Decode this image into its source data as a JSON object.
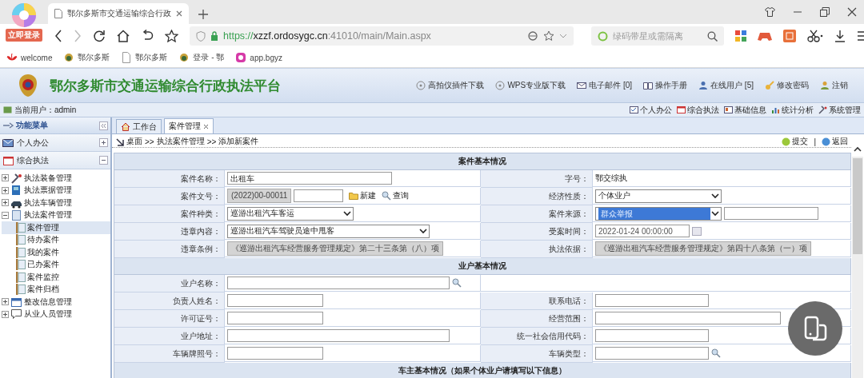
{
  "browser": {
    "tabs": [
      {
        "title": "鄂尔多斯市交通运输综合行政",
        "selected": true
      }
    ],
    "login_badge": "立即登录",
    "address": {
      "scheme": "https://",
      "host": "xzzf.ordosygc.cn",
      "path": ":41010/main/Main.aspx"
    },
    "search": {
      "placeholder": "绿码带星或需隔离"
    },
    "bookmarks": [
      {
        "label": "welcome"
      },
      {
        "label": "鄂尔多斯"
      },
      {
        "label": "鄂尔多斯"
      },
      {
        "label": "登录 - 鄂"
      },
      {
        "label": "app.bgyz"
      }
    ]
  },
  "app": {
    "title": "鄂尔多斯市交通运输综合行政执法平台",
    "links": [
      {
        "label": "高拍仪插件下载"
      },
      {
        "label": "WPS专业版下载"
      },
      {
        "label": "电子邮件 [0]"
      },
      {
        "label": "操作手册"
      },
      {
        "label": "在线用户 [5]"
      },
      {
        "label": "修改密码"
      },
      {
        "label": "注销"
      }
    ]
  },
  "user_bar": {
    "label": "当前用户：",
    "user": "admin",
    "modules": [
      {
        "label": "个人办公"
      },
      {
        "label": "综合执法"
      },
      {
        "label": "基础信息"
      },
      {
        "label": "统计分析"
      },
      {
        "label": "系统管理"
      }
    ]
  },
  "sidebar": {
    "title": "功能菜单",
    "panels": [
      {
        "label": "个人办公",
        "expanded": false
      },
      {
        "label": "综合执法",
        "expanded": true
      }
    ],
    "tree": [
      {
        "label": "执法装备管理",
        "expanded": false
      },
      {
        "label": "执法票据管理",
        "expanded": false
      },
      {
        "label": "执法车辆管理",
        "expanded": false
      },
      {
        "label": "执法案件管理",
        "expanded": true,
        "children": [
          {
            "label": "案件管理",
            "selected": true
          },
          {
            "label": "待办案件",
            "selected": false
          },
          {
            "label": "我的案件",
            "selected": false
          },
          {
            "label": "已办案件",
            "selected": false
          },
          {
            "label": "案件监控",
            "selected": false
          },
          {
            "label": "案件归档",
            "selected": false
          }
        ]
      },
      {
        "label": "整改信息管理",
        "expanded": false
      },
      {
        "label": "从业人员管理",
        "expanded": false
      }
    ]
  },
  "tabs": [
    {
      "label": "工作台",
      "selected": false,
      "closable": false
    },
    {
      "label": "案件管理",
      "selected": true,
      "closable": true
    }
  ],
  "breadcrumb": {
    "items": [
      "桌面",
      "执法案件管理",
      "添加新案件"
    ],
    "separator": ">>"
  },
  "actions": {
    "items": [
      {
        "label": "提交"
      },
      {
        "label": "返回"
      }
    ],
    "separator": "|"
  },
  "form": {
    "sections": [
      {
        "title": "案件基本情况",
        "rows": [
          [
            {
              "label": "案件名称：",
              "kind": "text",
              "value": "出租车"
            },
            {
              "label": "字号：",
              "kind": "static",
              "value": "鄂交综执"
            }
          ],
          [
            {
              "label": "案件文号：",
              "kind": "readonly",
              "value": "(2022)00-00011",
              "extra_input": true,
              "actions": [
                "新建",
                "查询"
              ]
            },
            {
              "label": "经济性质：",
              "kind": "select",
              "value": "个体业户"
            }
          ],
          [
            {
              "label": "案件种类：",
              "kind": "select",
              "value": "巡游出租汽车客运"
            },
            {
              "label": "案件来源：",
              "kind": "select",
              "value": "群众举报",
              "highlighted": true,
              "extra_input": true
            }
          ],
          [
            {
              "label": "违章内容：",
              "kind": "select",
              "value": "巡游出租汽车驾驶员途中甩客"
            },
            {
              "label": "受案时间：",
              "kind": "date",
              "value": "2022-01-24 00:00:00"
            }
          ],
          [
            {
              "label": "违章条例：",
              "kind": "readonly",
              "value": "《巡游出租汽车经营服务管理规定》第二十三条第（八）项"
            },
            {
              "label": "执法依据：",
              "kind": "readonly",
              "value": "《巡游出租汽车经营服务管理规定》第四十八条第（一）项"
            }
          ]
        ]
      },
      {
        "title": "业户基本情况",
        "rows": [
          [
            {
              "label": "业户名称：",
              "kind": "text",
              "lookup": true
            },
            null
          ],
          [
            {
              "label": "负责人姓名：",
              "kind": "text"
            },
            {
              "label": "联系电话：",
              "kind": "text"
            }
          ],
          [
            {
              "label": "许可证号：",
              "kind": "text"
            },
            {
              "label": "经营范围：",
              "kind": "text"
            }
          ],
          [
            {
              "label": "业户地址：",
              "kind": "text"
            },
            {
              "label": "统一社会信用代码：",
              "kind": "text"
            }
          ],
          [
            {
              "label": "车辆牌照号：",
              "kind": "text"
            },
            {
              "label": "车辆类型：",
              "kind": "text",
              "lookup": true
            }
          ]
        ]
      },
      {
        "title": "车主基本情况（如果个体业户请填写以下信息）"
      }
    ]
  }
}
